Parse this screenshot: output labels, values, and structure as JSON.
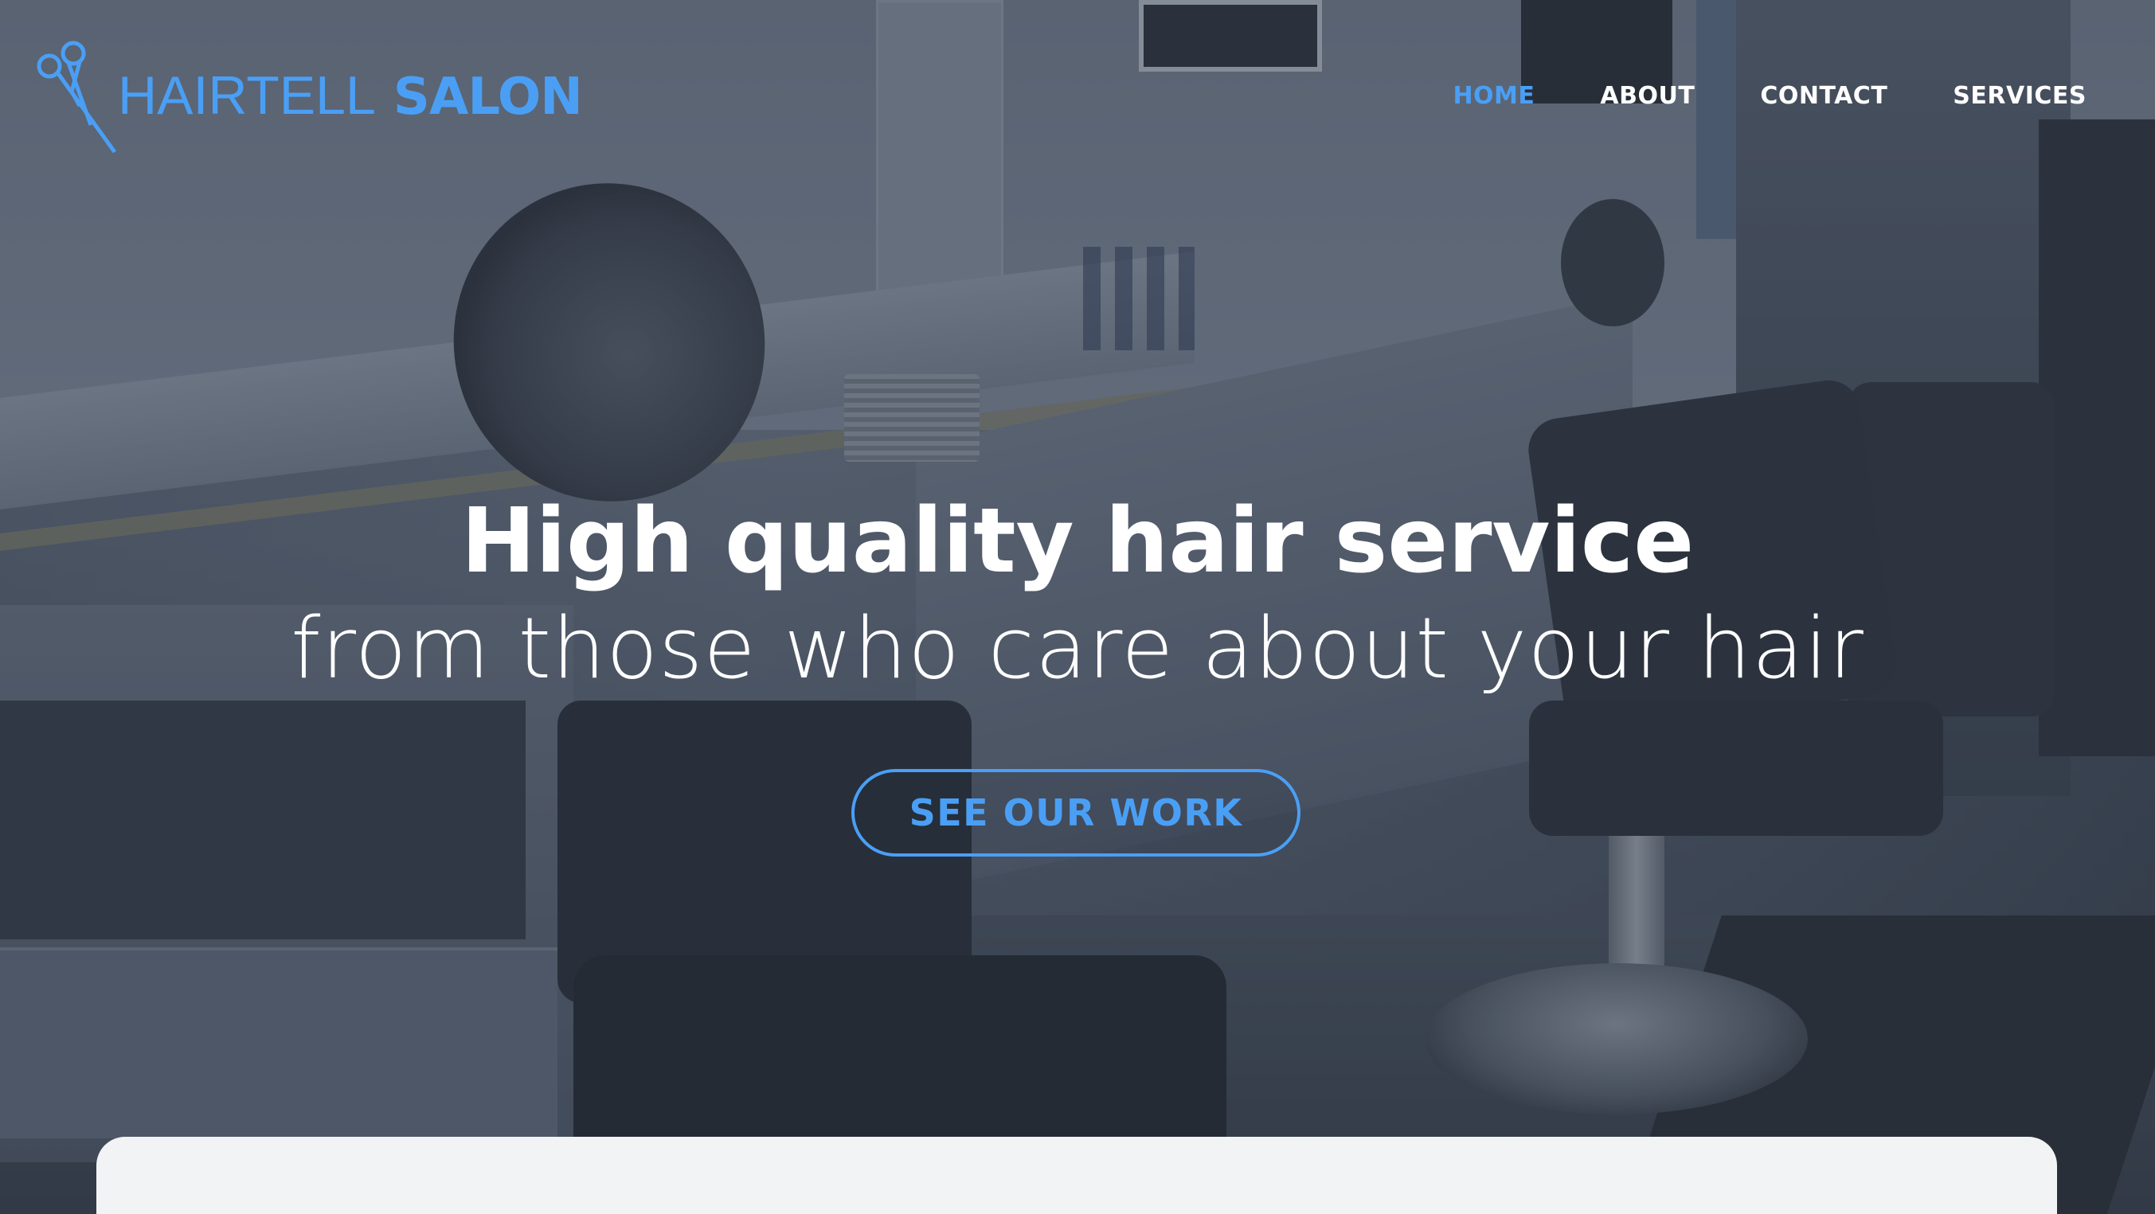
{
  "brand": {
    "name_light": "HAIRTELL",
    "name_bold": "SALON",
    "icon": "scissors-icon",
    "accent_color": "#4a9ff5"
  },
  "nav": {
    "items": [
      {
        "label": "HOME",
        "active": true
      },
      {
        "label": "ABOUT",
        "active": false
      },
      {
        "label": "CONTACT",
        "active": false
      },
      {
        "label": "SERVICES",
        "active": false
      }
    ]
  },
  "hero": {
    "headline": "High quality hair service",
    "subline": "from those who care about your hair",
    "cta_label": "SEE OUR WORK",
    "background": "salon interior photo"
  }
}
